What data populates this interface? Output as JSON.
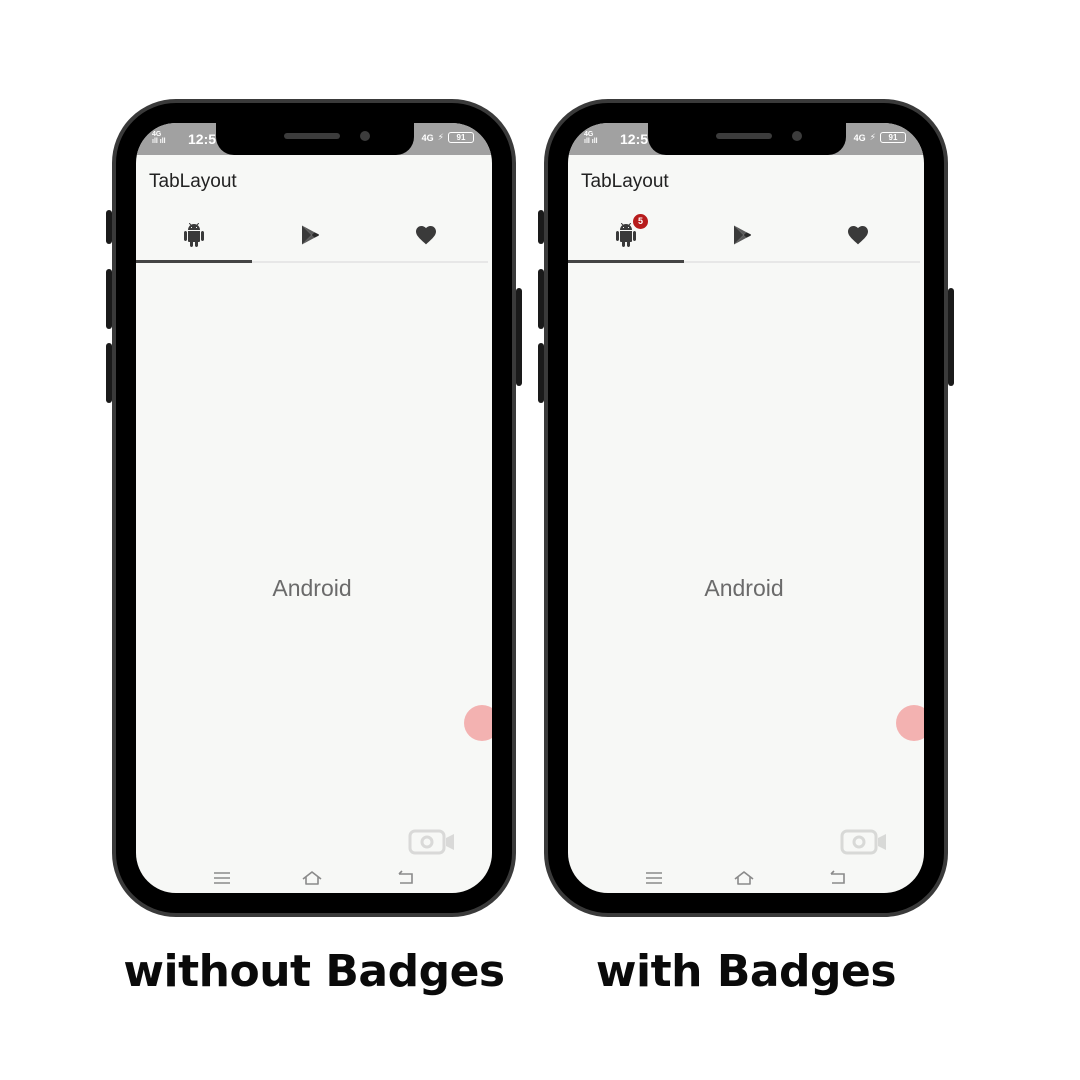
{
  "status_bar": {
    "network_label": "4G",
    "signal_text": "ıll ıll",
    "time": "12:5",
    "right_text": "4G",
    "battery": "91"
  },
  "app": {
    "title": "TabLayout",
    "tabs": [
      {
        "icon": "android-icon"
      },
      {
        "icon": "play-store-icon"
      },
      {
        "icon": "heart-icon"
      }
    ],
    "selected_tab": 0,
    "content_text": "Android"
  },
  "badge": {
    "count": "5",
    "color": "#b71c1c"
  },
  "captions": {
    "left": "without Badges",
    "right": "with Badges"
  },
  "colors": {
    "screen_bg": "#f7f8f6",
    "status_bar_bg": "#a1a1a1",
    "tab_indicator": "#444444",
    "frame": "#000000"
  }
}
